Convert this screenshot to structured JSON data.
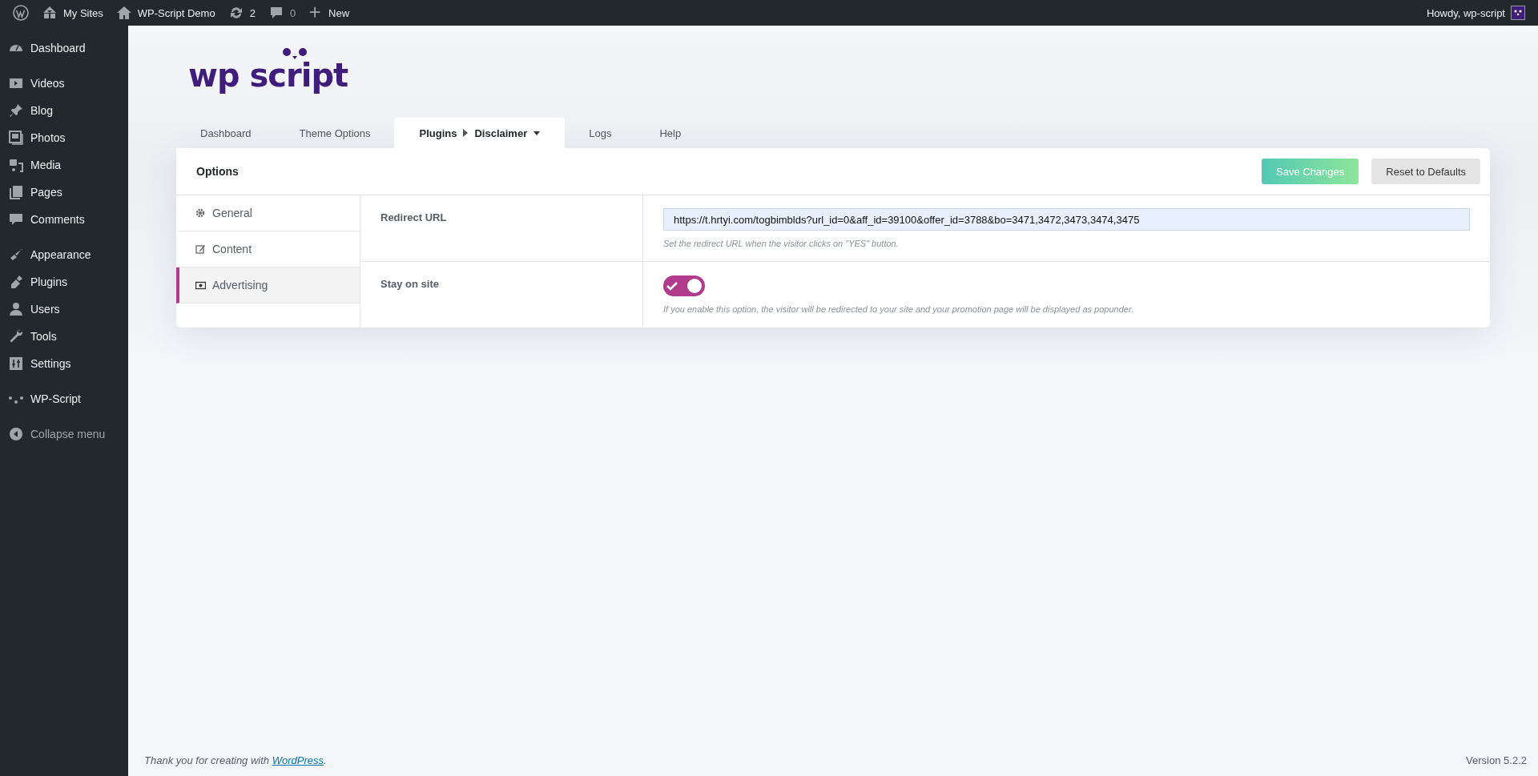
{
  "admin_bar": {
    "items": [
      {
        "kind": "logo"
      },
      {
        "kind": "sites",
        "label": "My Sites"
      },
      {
        "kind": "home",
        "label": "WP-Script Demo"
      },
      {
        "kind": "updates",
        "label": "2"
      },
      {
        "kind": "comments",
        "label": "0"
      },
      {
        "kind": "new",
        "label": "New"
      }
    ],
    "greeting": "Howdy, wp-script"
  },
  "sidebar": {
    "groups": [
      [
        {
          "label": "Dashboard"
        }
      ],
      [
        {
          "label": "Videos"
        },
        {
          "label": "Blog"
        },
        {
          "label": "Photos"
        },
        {
          "label": "Media"
        },
        {
          "label": "Pages"
        },
        {
          "label": "Comments"
        }
      ],
      [
        {
          "label": "Appearance"
        },
        {
          "label": "Plugins"
        },
        {
          "label": "Users"
        },
        {
          "label": "Tools"
        },
        {
          "label": "Settings"
        }
      ],
      [
        {
          "label": "WP-Script"
        }
      ]
    ],
    "collapse_label": "Collapse menu"
  },
  "logo": {
    "text": "wp script"
  },
  "tabs": [
    {
      "label": "Dashboard",
      "selected": false
    },
    {
      "label": "Theme Options",
      "selected": false
    },
    {
      "label": "Plugins",
      "sub": "Disclaimer",
      "selected": true
    },
    {
      "label": "Logs",
      "selected": false
    },
    {
      "label": "Help",
      "selected": false
    }
  ],
  "options": {
    "title": "Options",
    "buttons": [
      {
        "kind": "primary",
        "label": "Save Changes"
      },
      {
        "kind": "secondary",
        "label": "Reset to Defaults"
      }
    ],
    "nav": [
      {
        "label": "General",
        "selected": false
      },
      {
        "label": "Content",
        "selected": false
      },
      {
        "label": "Advertising",
        "selected": true
      }
    ],
    "fields": [
      {
        "kind": "text",
        "label": "Redirect URL",
        "value": "https://t.hrtyi.com/togbimblds?url_id=0&aff_id=39100&offer_id=3788&bo=3471,3472,3473,3474,3475",
        "description": "Set the redirect URL when the visitor clicks on \"YES\" button."
      },
      {
        "kind": "toggle",
        "label": "Stay on site",
        "on": true,
        "description": "If you enable this option, the visitor will be redirected to your site and your promotion page will be displayed as popunder."
      }
    ]
  },
  "footer": {
    "text": "Thank you for creating with ",
    "link": "WordPress",
    "after": ".",
    "version": "Version 5.2.2"
  }
}
